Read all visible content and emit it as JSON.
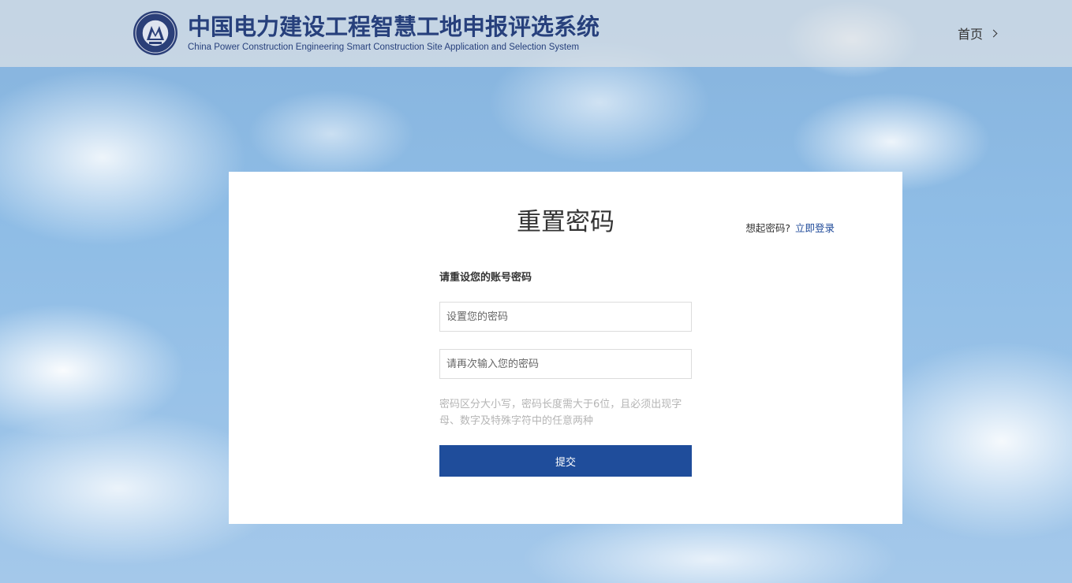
{
  "header": {
    "title_cn": "中国电力建设工程智慧工地申报评选系统",
    "title_en": "China Power Construction Engineering Smart Construction Site Application and Selection System",
    "home_link": "首页",
    "logo_icon": "association-seal-icon"
  },
  "card": {
    "title": "重置密码",
    "remember_text": "想起密码?",
    "login_link": "立即登录",
    "form_label": "请重设您的账号密码",
    "password_placeholder": "设置您的密码",
    "confirm_placeholder": "请再次输入您的密码",
    "password_value": "",
    "confirm_value": "",
    "hint": "密码区分大小写，密码长度需大于6位，且必须出现字母、数字及特殊字符中的任意两种",
    "submit_label": "提交"
  },
  "colors": {
    "brand": "#1f4d9b",
    "title_blue": "#27407c",
    "link": "#1f4a99",
    "hint": "#b5b5b5"
  }
}
